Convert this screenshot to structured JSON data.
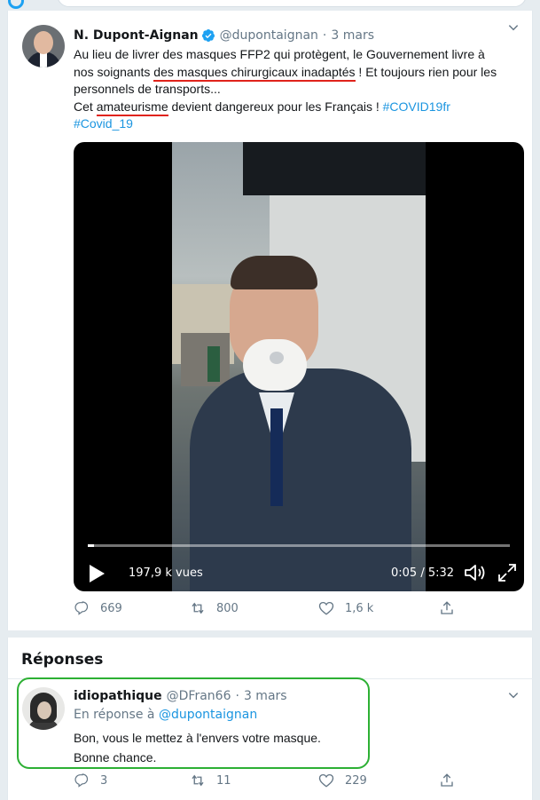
{
  "tweet": {
    "author_name": "N. Dupont-Aignan",
    "handle": "@dupontaignan",
    "separator": "·",
    "date": "3 mars",
    "text": {
      "l1": "Au lieu de livrer des masques FFP2 qui protègent, le Gouvernement livre à",
      "l2_a": "nos soignants ",
      "l2_b": "des masques chirurgicaux inadaptés",
      "l2_c": " ! Et toujours rien pour les",
      "l3": "personnels de transports...",
      "l4_a": "Cet ",
      "l4_b": "amateurisme",
      "l4_c": " devient dangereux pour les Français ! ",
      "l4_hashtag": "#COVID19fr",
      "l5_hashtag": "#Covid_19"
    },
    "video": {
      "views": "197,9 k vues",
      "time": "0:05 / 5:32",
      "progress": 0.015
    },
    "actions": {
      "replies": "669",
      "retweets": "800",
      "likes": "1,6 k"
    }
  },
  "replies": {
    "title": "Réponses",
    "items": [
      {
        "name": "idiopathique",
        "handle": "@DFran66",
        "separator": "·",
        "date": "3 mars",
        "reply_to_prefix": "En réponse à ",
        "reply_to_handle": "@dupontaignan",
        "text_l1": "Bon, vous le mettez à l'envers votre masque.",
        "text_l2": "Bonne chance.",
        "actions": {
          "replies": "3",
          "retweets": "11",
          "likes": "229"
        }
      }
    ]
  },
  "colors": {
    "accent": "#1da1f2",
    "link": "#1b95e0",
    "muted": "#657786",
    "annotation_red": "#e0231b",
    "annotation_green": "#2db034"
  },
  "icons": {
    "verified": "verified-badge-icon",
    "chevron": "chevron-down-icon",
    "play": "play-icon",
    "volume": "volume-icon",
    "fullscreen": "fullscreen-icon",
    "reply": "reply-icon",
    "retweet": "retweet-icon",
    "like": "like-icon",
    "share": "share-icon"
  }
}
